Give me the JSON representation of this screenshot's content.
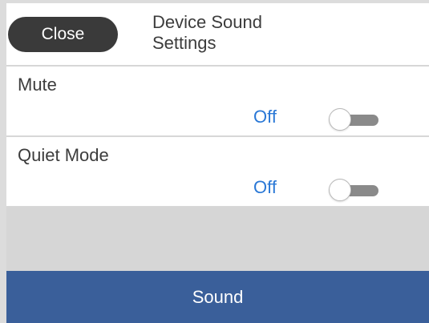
{
  "header": {
    "close_label": "Close",
    "title_line1": "Device Sound",
    "title_line2": "Settings"
  },
  "settings": [
    {
      "label": "Mute",
      "value": "Off",
      "toggle_state": "off"
    },
    {
      "label": "Quiet Mode",
      "value": "Off",
      "toggle_state": "off"
    }
  ],
  "footer": {
    "tab_label": "Sound"
  },
  "colors": {
    "close_button": "#3a3a3a",
    "value_text": "#2a78d6",
    "footer_bar": "#3a5f9a",
    "empty_area": "#d6d6d6"
  }
}
